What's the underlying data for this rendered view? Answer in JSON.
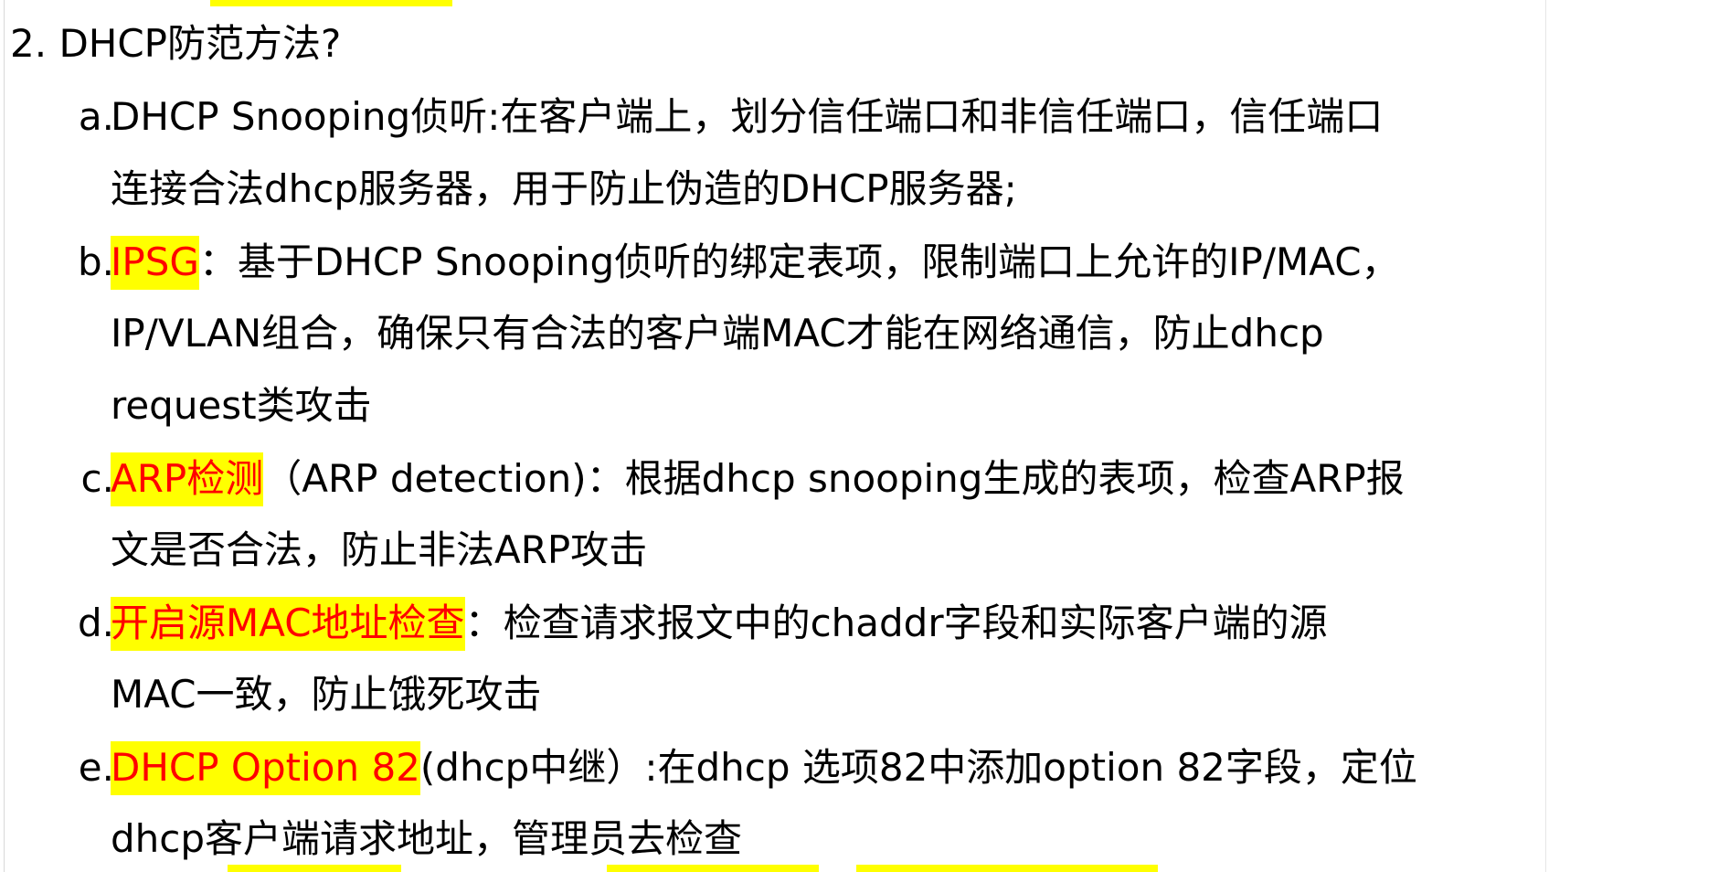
{
  "heading": {
    "number": "2.",
    "text": "DHCP防范方法?"
  },
  "items": [
    {
      "marker": "a.",
      "highlight": "",
      "lines": [
        "DHCP Snooping侦听:在客户端上，划分信任端口和非信任端口，信任端口",
        "连接合法dhcp服务器，用于防止伪造的DHCP服务器;"
      ]
    },
    {
      "marker": "b.",
      "highlight": "IPSG",
      "first_rest": "：基于DHCP Snooping侦听的绑定表项，限制端口上允许的IP/MAC，",
      "lines": [
        "IP/VLAN组合，确保只有合法的客户端MAC才能在网络通信，防止dhcp",
        "request类攻击"
      ]
    },
    {
      "marker": "c.",
      "highlight": "ARP检测",
      "first_rest": "（ARP detection)：根据dhcp snooping生成的表项，检查ARP报",
      "lines": [
        "文是否合法，防止非法ARP攻击"
      ]
    },
    {
      "marker": "d.",
      "highlight": "开启源MAC地址检查",
      "first_rest": "：检查请求报文中的chaddr字段和实际客户端的源",
      "lines": [
        "MAC一致，防止饿死攻击"
      ]
    },
    {
      "marker": "e.",
      "highlight": "DHCP Option 82",
      "first_rest": "(dhcp中继）:在dhcp 选项82中添加option 82字段，定位",
      "lines": [
        "dhcp客户端请求地址，管理员去检查"
      ]
    }
  ],
  "colors": {
    "highlight_bg": "#ffff00",
    "highlight_text": "#ff0000",
    "text": "#000000",
    "background": "#ffffff"
  }
}
